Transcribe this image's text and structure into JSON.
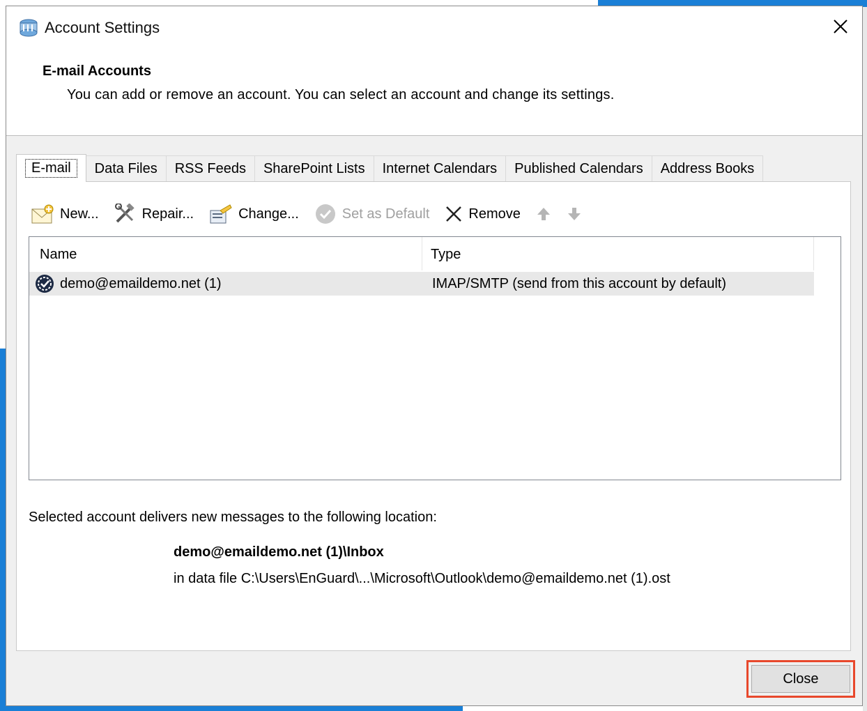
{
  "window": {
    "title": "Account Settings",
    "heading": "E-mail Accounts",
    "subheading": "You can add or remove an account. You can select an account and change its settings."
  },
  "tabs": [
    {
      "label": "E-mail",
      "active": true
    },
    {
      "label": "Data Files"
    },
    {
      "label": "RSS Feeds"
    },
    {
      "label": "SharePoint Lists"
    },
    {
      "label": "Internet Calendars"
    },
    {
      "label": "Published Calendars"
    },
    {
      "label": "Address Books"
    }
  ],
  "toolbar": {
    "new_label": "New...",
    "repair_label": "Repair...",
    "change_label": "Change...",
    "set_default_label": "Set as Default",
    "remove_label": "Remove"
  },
  "accounts_list": {
    "columns": {
      "name": "Name",
      "type": "Type"
    },
    "rows": [
      {
        "name": "demo@emaildemo.net (1)",
        "type": "IMAP/SMTP (send from this account by default)"
      }
    ]
  },
  "delivery": {
    "label": "Selected account delivers new messages to the following location:",
    "folder": "demo@emaildemo.net (1)\\Inbox",
    "data_file": "in data file C:\\Users\\EnGuard\\...\\Microsoft\\Outlook\\demo@emaildemo.net (1).ost"
  },
  "footer": {
    "close_label": "Close"
  },
  "colors": {
    "highlight": "#e8482c",
    "selected_row": "#e8e8e8",
    "desktop_blue": "#1a7fd6"
  }
}
